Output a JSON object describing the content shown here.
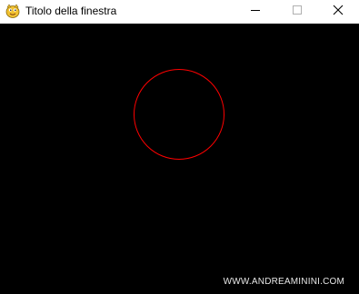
{
  "window": {
    "title": "Titolo della finestra",
    "app_icon": "pygame-snake-icon",
    "background_color": "#000000",
    "titlebar_color": "#ffffff"
  },
  "controls": {
    "minimize_icon": "minimize-icon",
    "maximize_icon": "maximize-icon",
    "close_icon": "close-icon"
  },
  "canvas": {
    "shape": "circle",
    "stroke_color": "#ff0000",
    "fill": "none"
  },
  "watermark": {
    "text": "WWW.ANDREAMININI.COM"
  }
}
